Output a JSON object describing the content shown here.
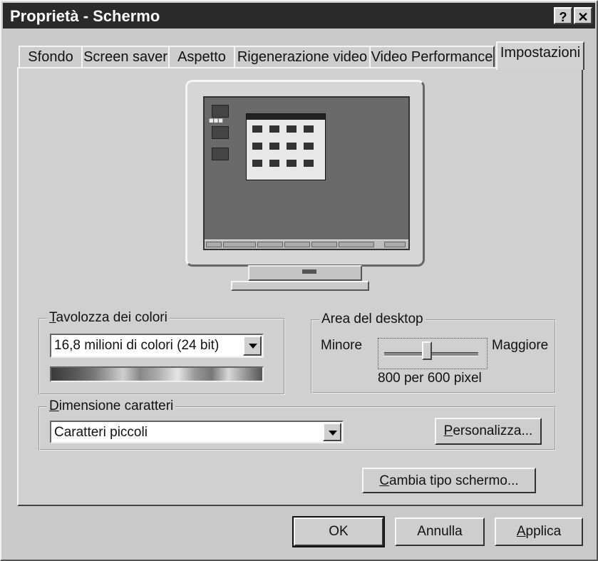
{
  "window": {
    "title": "Proprietà - Schermo",
    "help_button": "?",
    "close_button": "✕"
  },
  "tabs": [
    {
      "label": "Sfondo"
    },
    {
      "label": "Screen saver"
    },
    {
      "label": "Aspetto"
    },
    {
      "label": "Rigenerazione video"
    },
    {
      "label": "Video Performance"
    },
    {
      "label": "Impostazioni",
      "active": true
    }
  ],
  "color_palette": {
    "legend_prefix": "",
    "legend_accel": "T",
    "legend_rest": "avolozza dei colori",
    "selected": "16,8 milioni di colori (24 bit)"
  },
  "desktop_area": {
    "legend": "Area del desktop",
    "min_label": "Minore",
    "max_label": "Maggiore",
    "value_text": "800 per 600 pixel",
    "slider_level": 0.45
  },
  "font_size": {
    "legend_accel": "D",
    "legend_rest": "imensione caratteri",
    "selected": "Caratteri piccoli",
    "customize_accel": "P",
    "customize_rest": "ersonalizza..."
  },
  "change_display": {
    "accel": "C",
    "rest": "ambia tipo schermo..."
  },
  "footer": {
    "ok": "OK",
    "cancel": "Annulla",
    "apply_accel": "A",
    "apply_rest": "pplica"
  },
  "colors": {
    "title_bar": "#2a2a2a",
    "dialog_bg": "#c9c9c9"
  }
}
